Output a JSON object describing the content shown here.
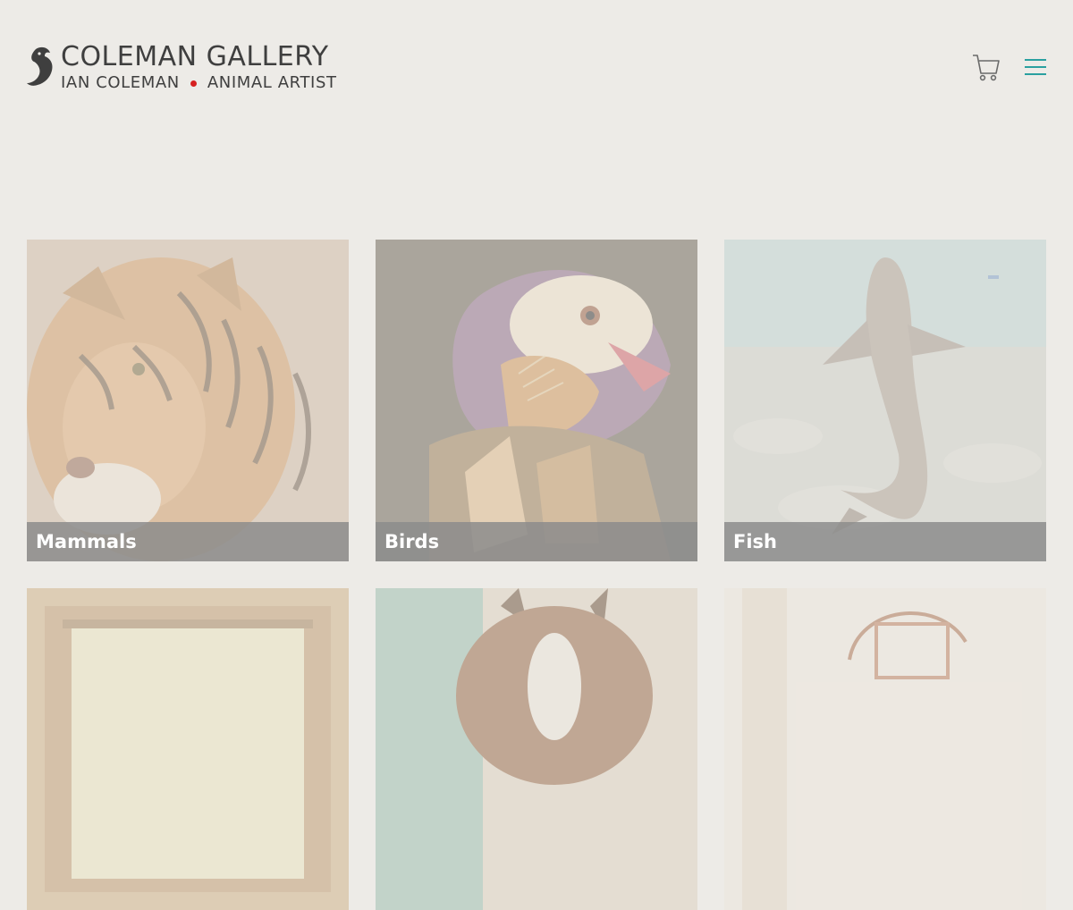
{
  "header": {
    "title": "COLEMAN GALLERY",
    "subtitle_left": "IAN COLEMAN",
    "subtitle_right": "ANIMAL ARTIST",
    "cart_icon": "shopping-cart-icon",
    "menu_icon": "hamburger-menu-icon",
    "accent_color": "#2aa0a0",
    "dot_color": "#d62020"
  },
  "categories": [
    {
      "label": "Mammals"
    },
    {
      "label": "Birds"
    },
    {
      "label": "Fish"
    },
    {
      "label": ""
    },
    {
      "label": ""
    },
    {
      "label": ""
    }
  ]
}
